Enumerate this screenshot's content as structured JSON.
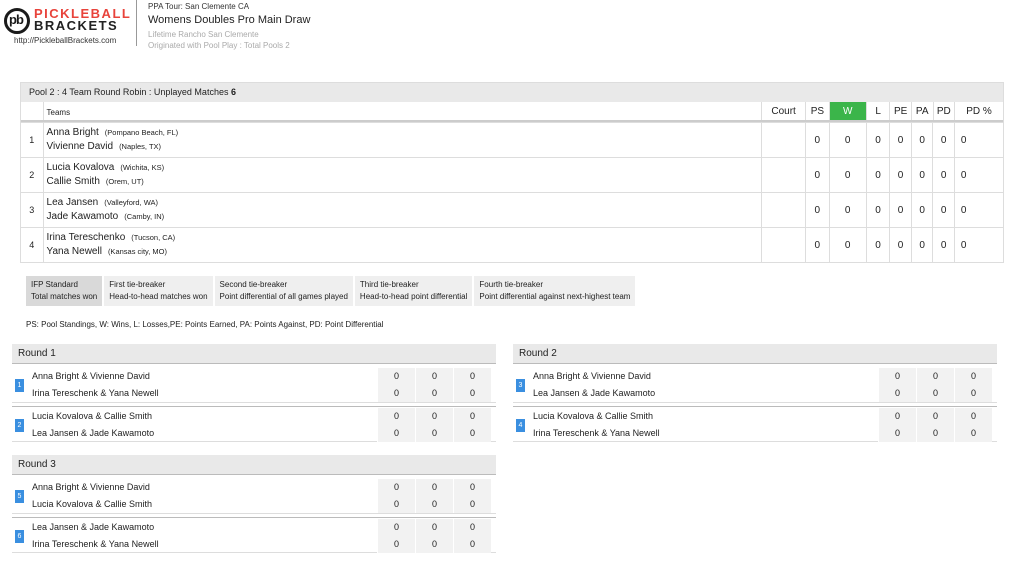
{
  "brand": {
    "mark": "pb",
    "line1": "PICKLEBALL",
    "line2": "BRACKETS",
    "url": "http://PickleballBrackets.com"
  },
  "header": {
    "tour": "PPA Tour: San Clemente CA",
    "title": "Womens Doubles Pro Main Draw",
    "venue": "Lifetime Rancho San Clemente",
    "origin": "Originated with Pool Play : Total Pools 2"
  },
  "pool": {
    "title": "Pool 2 : 4 Team Round Robin : Unplayed Matches",
    "unplayed": "6",
    "headers": {
      "teams": "Teams",
      "court": "Court",
      "ps": "PS",
      "w": "W",
      "l": "L",
      "pe": "PE",
      "pa": "PA",
      "pd": "PD",
      "pdp": "PD %"
    },
    "rows": [
      {
        "num": "1",
        "p1": "Anna Bright",
        "l1": "(Pompano Beach, FL)",
        "p2": "Vivienne David",
        "l2": "(Naples, TX)",
        "ps": "0",
        "w": "0",
        "l": "0",
        "pe": "0",
        "pa": "0",
        "pd": "0",
        "pdp": "0"
      },
      {
        "num": "2",
        "p1": "Lucia Kovalova",
        "l1": "(Wichita, KS)",
        "p2": "Callie Smith",
        "l2": "(Orem, UT)",
        "ps": "0",
        "w": "0",
        "l": "0",
        "pe": "0",
        "pa": "0",
        "pd": "0",
        "pdp": "0"
      },
      {
        "num": "3",
        "p1": "Lea Jansen",
        "l1": "(Valleyford, WA)",
        "p2": "Jade Kawamoto",
        "l2": "(Camby, IN)",
        "ps": "0",
        "w": "0",
        "l": "0",
        "pe": "0",
        "pa": "0",
        "pd": "0",
        "pdp": "0"
      },
      {
        "num": "4",
        "p1": "Irina Tereschenko",
        "l1": "(Tucson, CA)",
        "p2": "Yana Newell",
        "l2": "(Kansas city, MO)",
        "ps": "0",
        "w": "0",
        "l": "0",
        "pe": "0",
        "pa": "0",
        "pd": "0",
        "pdp": "0"
      }
    ]
  },
  "tiebreakers": [
    {
      "title": "IFP Standard",
      "desc": "Total matches won"
    },
    {
      "title": "First tie-breaker",
      "desc": "Head-to-head matches won"
    },
    {
      "title": "Second tie-breaker",
      "desc": "Point differential of all games played"
    },
    {
      "title": "Third tie-breaker",
      "desc": "Head-to-head point differential"
    },
    {
      "title": "Fourth tie-breaker",
      "desc": "Point differential against next-highest team"
    }
  ],
  "legend": "PS: Pool Standings, W: Wins, L: Losses,PE: Points Earned, PA: Points Against, PD: Point Differential",
  "rounds": [
    {
      "title": "Round 1",
      "matches": [
        {
          "num": "1",
          "t1": "Anna Bright & Vivienne David",
          "t2": "Irina Tereschenk & Yana Newell",
          "s1": [
            "0",
            "0",
            "0"
          ],
          "s2": [
            "0",
            "0",
            "0"
          ]
        },
        {
          "num": "2",
          "t1": "Lucia Kovalova & Callie Smith",
          "t2": "Lea Jansen & Jade Kawamoto",
          "s1": [
            "0",
            "0",
            "0"
          ],
          "s2": [
            "0",
            "0",
            "0"
          ]
        }
      ]
    },
    {
      "title": "Round 2",
      "matches": [
        {
          "num": "3",
          "t1": "Anna Bright & Vivienne David",
          "t2": "Lea Jansen & Jade Kawamoto",
          "s1": [
            "0",
            "0",
            "0"
          ],
          "s2": [
            "0",
            "0",
            "0"
          ]
        },
        {
          "num": "4",
          "t1": "Lucia Kovalova & Callie Smith",
          "t2": "Irina Tereschenk & Yana Newell",
          "s1": [
            "0",
            "0",
            "0"
          ],
          "s2": [
            "0",
            "0",
            "0"
          ]
        }
      ]
    },
    {
      "title": "Round 3",
      "matches": [
        {
          "num": "5",
          "t1": "Anna Bright & Vivienne David",
          "t2": "Lucia Kovalova & Callie Smith",
          "s1": [
            "0",
            "0",
            "0"
          ],
          "s2": [
            "0",
            "0",
            "0"
          ]
        },
        {
          "num": "6",
          "t1": "Lea Jansen & Jade Kawamoto",
          "t2": "Irina Tereschenk & Yana Newell",
          "s1": [
            "0",
            "0",
            "0"
          ],
          "s2": [
            "0",
            "0",
            "0"
          ]
        }
      ]
    }
  ]
}
